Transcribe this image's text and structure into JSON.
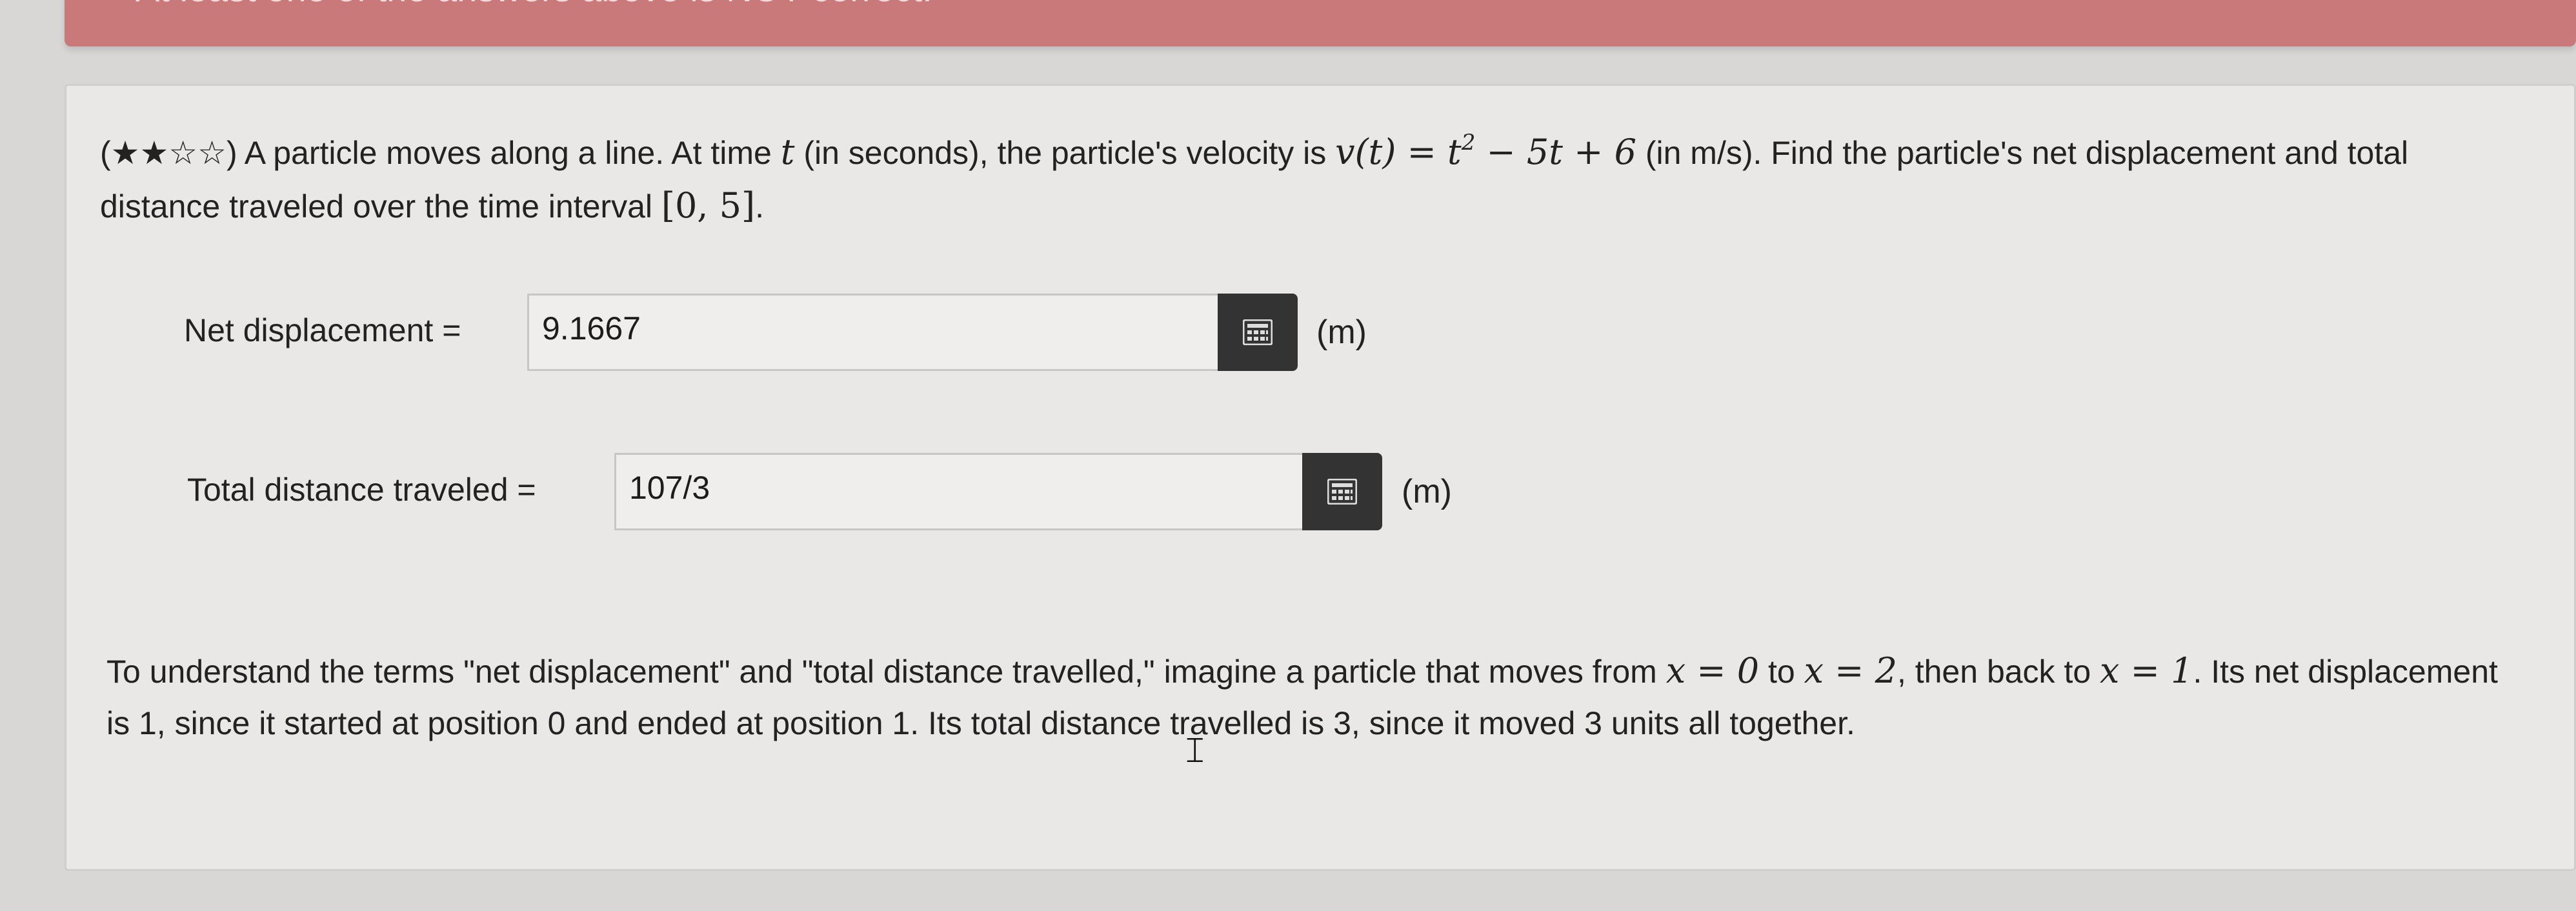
{
  "alert": {
    "text": "At least one of the answers above is NOT correct."
  },
  "question": {
    "stars": "(★★☆☆)",
    "text_1": " A particle moves along a line. At time ",
    "var_t": "t",
    "text_2": " (in seconds), the particle's velocity is ",
    "v_of_t": "v(t)",
    "eq": " = ",
    "t_squared_base": "t",
    "exponent": "2",
    "rest_of_expr": " − 5t + 6",
    "text_3": " (in m/s). Find the particle's net displacement and total distance traveled over the time interval ",
    "interval": "[0, 5]",
    "period": "."
  },
  "answers": [
    {
      "label": "Net displacement =",
      "value": "9.1667",
      "unit": "(m)"
    },
    {
      "label": "Total distance traveled =",
      "value": "107/3",
      "unit": "(m)"
    }
  ],
  "hint": {
    "text_1": "To understand the terms \"net displacement\" and \"total distance travelled,\" imagine a particle that moves from ",
    "x_eq_0": "x = 0",
    "to": " to ",
    "x_eq_2": "x = 2",
    "text_2": ", then back to ",
    "x_eq_1": "x = 1",
    "text_3": ". Its net displacement is 1, since it started at position 0 and ended at position 1. Its total distance travelled is 3, since it moved 3 units all together."
  },
  "icons": {
    "keypad": "calculator-keypad-icon",
    "cursor": "text-cursor-icon"
  },
  "colors": {
    "alert": "#c9797a",
    "keypad_button": "#333333",
    "panel": "#e9e8e6"
  }
}
